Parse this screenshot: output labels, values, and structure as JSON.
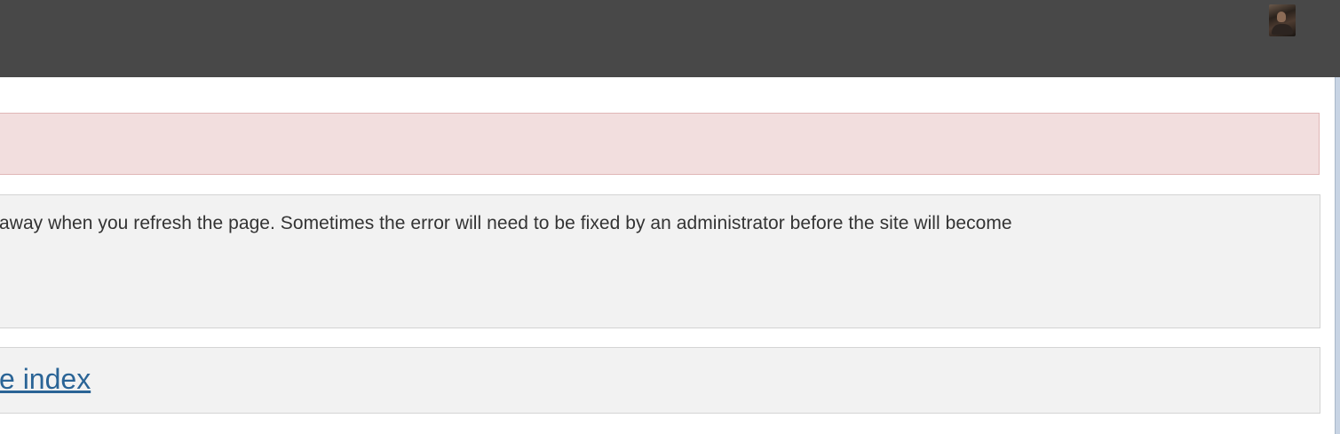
{
  "header": {
    "avatar_icon": "user-avatar",
    "background_color": "#484848"
  },
  "alert": {
    "text": "",
    "background_color": "#f2dede",
    "border_color": "#e0b7b7"
  },
  "info": {
    "text": "away when you refresh the page. Sometimes the error will need to be fixed by an administrator before the site will become"
  },
  "nav": {
    "index_link_label": "e index",
    "link_color": "#2a6496"
  }
}
